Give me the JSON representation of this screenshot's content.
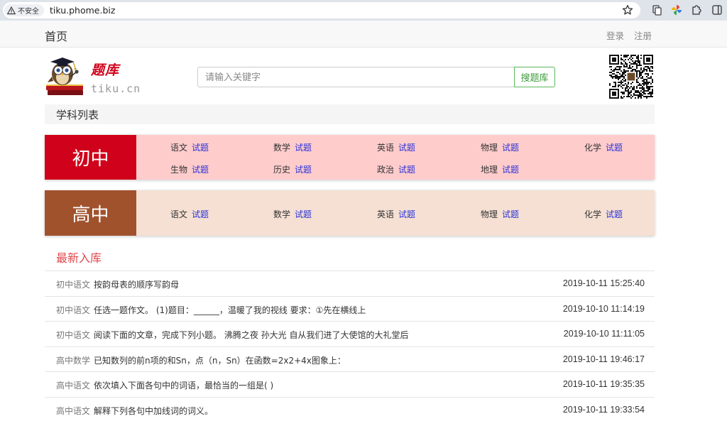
{
  "browser": {
    "security_label": "不安全",
    "url": "tiku.phome.biz"
  },
  "nav": {
    "home": "首页",
    "login": "登录",
    "register": "注册"
  },
  "logo": {
    "title": "题库",
    "domain": "tiku.cn"
  },
  "search": {
    "placeholder": "请输入关键字",
    "button": "搜题库"
  },
  "section_title": "学科列表",
  "levels": [
    {
      "name": "初中",
      "color": "#d0021b",
      "bg": "#ffcccc",
      "subjects": [
        {
          "name": "语文",
          "link": "试题"
        },
        {
          "name": "数学",
          "link": "试题"
        },
        {
          "name": "英语",
          "link": "试题"
        },
        {
          "name": "物理",
          "link": "试题"
        },
        {
          "name": "化学",
          "link": "试题"
        },
        {
          "name": "生物",
          "link": "试题"
        },
        {
          "name": "历史",
          "link": "试题"
        },
        {
          "name": "政治",
          "link": "试题"
        },
        {
          "name": "地理",
          "link": "试题"
        }
      ]
    },
    {
      "name": "高中",
      "color": "#a0522d",
      "bg": "#f5e0d3",
      "subjects": [
        {
          "name": "语文",
          "link": "试题"
        },
        {
          "name": "数学",
          "link": "试题"
        },
        {
          "name": "英语",
          "link": "试题"
        },
        {
          "name": "物理",
          "link": "试题"
        },
        {
          "name": "化学",
          "link": "试题"
        }
      ]
    }
  ],
  "latest": {
    "title": "最新入库",
    "items": [
      {
        "category": "初中语文",
        "question": "按韵母表的顺序写韵母",
        "date": "2019-10-11 15:25:40"
      },
      {
        "category": "初中语文",
        "question": "任选一题作文。 (1)题目：______，温暖了我的视线 要求：①先在横线上",
        "date": "2019-10-10 11:14:19"
      },
      {
        "category": "初中语文",
        "question": "阅读下面的文章，完成下列小题。 沸腾之夜 孙大光 自从我们进了大使馆的大礼堂后",
        "date": "2019-10-10 11:11:05"
      },
      {
        "category": "高中数学",
        "question": "已知数列的前n项的和Sn，点（n，Sn）在函数=2x2+4x图象上：",
        "date": "2019-10-11 19:46:17"
      },
      {
        "category": "高中语文",
        "question": "依次填入下面各句中的词语，最恰当的一组是( )",
        "date": "2019-10-11 19:35:35"
      },
      {
        "category": "高中语文",
        "question": "解释下列各句中加线词的词义。",
        "date": "2019-10-11 19:33:54"
      }
    ]
  }
}
